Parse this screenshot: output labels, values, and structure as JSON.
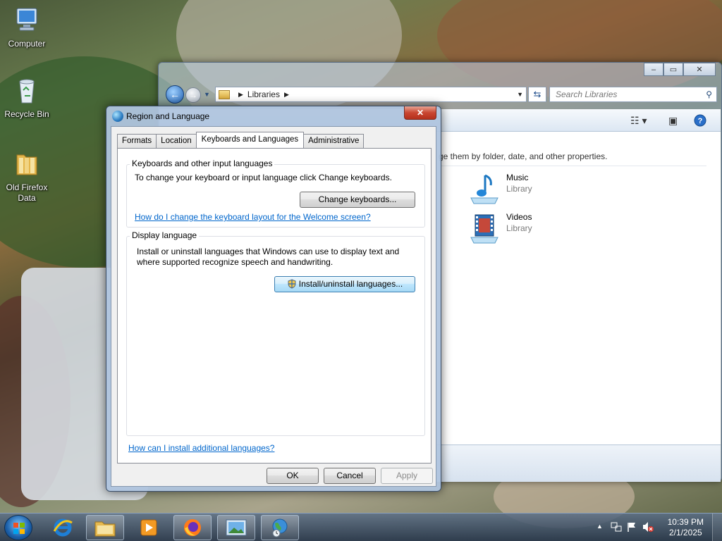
{
  "desktop": {
    "icons": [
      {
        "label": "Computer"
      },
      {
        "label": "Recycle Bin"
      },
      {
        "label": "Old Firefox Data"
      }
    ]
  },
  "explorer": {
    "breadcrumb": "Libraries",
    "search_placeholder": "Search Libraries",
    "description": "ge them by folder, date, and other properties.",
    "libraries": [
      {
        "name": "Music",
        "type": "Library",
        "icon": "music-library-icon"
      },
      {
        "name": "Videos",
        "type": "Library",
        "icon": "videos-library-icon"
      }
    ],
    "window_controls": {
      "minimize": "–",
      "maximize": "▭",
      "close": "✕"
    }
  },
  "dialog": {
    "title": "Region and Language",
    "close": "✕",
    "tabs": [
      {
        "label": "Formats",
        "active": false
      },
      {
        "label": "Location",
        "active": false
      },
      {
        "label": "Keyboards and Languages",
        "active": true
      },
      {
        "label": "Administrative",
        "active": false
      }
    ],
    "keyboards_group": {
      "title": "Keyboards and other input languages",
      "text": "To change your keyboard or input language click Change keyboards.",
      "button": "Change keyboards...",
      "link": "How do I change the keyboard layout for the Welcome screen?"
    },
    "display_group": {
      "title": "Display language",
      "text_line1": "Install or uninstall languages that Windows can use to display text and",
      "text_line2": "where supported recognize speech and handwriting.",
      "button": "Install/uninstall languages..."
    },
    "bottom_link": "How can I install additional languages?",
    "buttons": {
      "ok": "OK",
      "cancel": "Cancel",
      "apply": "Apply"
    }
  },
  "taskbar": {
    "pinned": [
      "internet-explorer-icon",
      "windows-explorer-icon",
      "media-player-icon",
      "firefox-icon",
      "picture-viewer-icon",
      "region-language-icon"
    ],
    "clock": {
      "time": "10:39 PM",
      "date": "2/1/2025"
    },
    "tray_chevron": "▲"
  }
}
